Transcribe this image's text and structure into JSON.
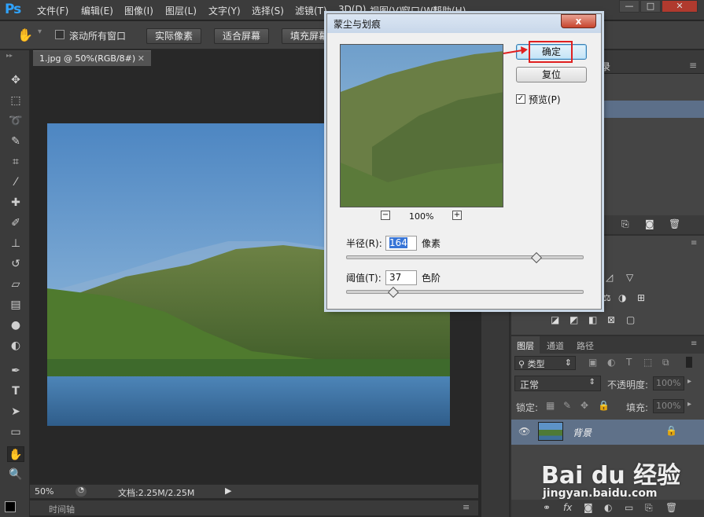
{
  "app": {
    "logo": "Ps"
  },
  "menu": [
    "文件(F)",
    "编辑(E)",
    "图像(I)",
    "图层(L)",
    "文字(Y)",
    "选择(S)",
    "滤镜(T)",
    "3D(D)",
    "视图(V)",
    "窗口(W)",
    "帮助(H)"
  ],
  "options": {
    "scroll_all_label": "滚动所有窗口",
    "scroll_all_checked": false,
    "actual_pixels": "实际像素",
    "fit_screen": "适合屏幕",
    "fill_screen": "填充屏幕"
  },
  "document": {
    "tab": "1.jpg @ 50%(RGB/8#)"
  },
  "status": {
    "zoom": "50%",
    "doc_size": "文档:2.25M/2.25M"
  },
  "timeline": {
    "label": "时间轴"
  },
  "dialog": {
    "title": "蒙尘与划痕",
    "close": "x",
    "ok": "确定",
    "reset": "复位",
    "preview_label": "预览(P)",
    "preview_checked": true,
    "zoom": "100%",
    "zoom_out": "−",
    "zoom_in": "+",
    "radius_label": "半径(R):",
    "radius_value": "164",
    "radius_unit": "像素",
    "radius_level": 0.8,
    "threshold_label": "阈值(T):",
    "threshold_value": "37",
    "threshold_unit": "色阶",
    "threshold_level": 0.2
  },
  "panels": {
    "history_tab_fragment": "录",
    "layers_tabs": [
      "图层",
      "通道",
      "路径"
    ],
    "kind_filter": "类型",
    "blend_mode": "正常",
    "opacity_label": "不透明度:",
    "opacity_value": "100%",
    "lock_label": "锁定:",
    "fill_label": "填充:",
    "fill_value": "100%",
    "layer_name": "背景"
  },
  "watermark": {
    "brand": "Bai du 经验",
    "url": "jingyan.baidu.com"
  },
  "colors": {
    "highlight": "#e02020",
    "accent": "#2fa3ff"
  }
}
